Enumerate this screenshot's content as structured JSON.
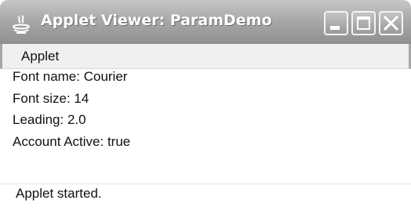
{
  "window": {
    "title": "Applet Viewer: ParamDemo",
    "app_icon": "java-icon",
    "controls": {
      "minimize_icon": "minimize-icon",
      "maximize_icon": "maximize-icon",
      "close_icon": "close-icon"
    }
  },
  "menubar": {
    "items": [
      {
        "label": "Applet"
      }
    ]
  },
  "content": {
    "lines": [
      "Font name: Courier",
      "Font size: 14",
      "Leading: 2.0",
      "Account Active: true"
    ]
  },
  "status": {
    "text": "Applet started."
  }
}
